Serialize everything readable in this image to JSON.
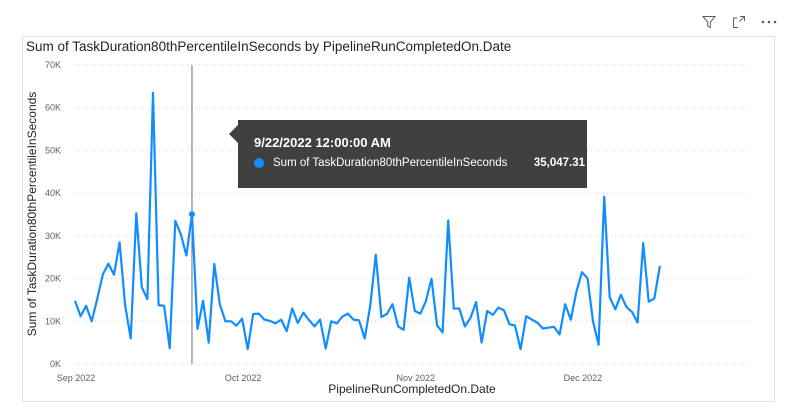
{
  "header_icons": [
    "filter-icon",
    "focus-mode-icon",
    "more-options-icon"
  ],
  "chart_data": {
    "type": "line",
    "title": "Sum of TaskDuration80thPercentileInSeconds by PipelineRunCompletedOn.Date",
    "xlabel": "PipelineRunCompletedOn.Date",
    "ylabel": "Sum of TaskDuration80thPercentileInSeconds",
    "x_ticks": [
      "Sep 2022",
      "Oct 2022",
      "Nov 2022",
      "Dec 2022"
    ],
    "y_ticks": [
      "0K",
      "10K",
      "20K",
      "30K",
      "40K",
      "50K",
      "60K",
      "70K"
    ],
    "ylim": [
      0,
      70000
    ],
    "x_start": "2022-09-01",
    "x_end": "2022-12-31",
    "grid": "horizontal dotted",
    "color": "#118DFF",
    "series": [
      {
        "name": "Sum of TaskDuration80thPercentileInSeconds",
        "points": [
          [
            "2022-09-01",
            14800
          ],
          [
            "2022-09-02",
            11200
          ],
          [
            "2022-09-03",
            13600
          ],
          [
            "2022-09-04",
            10000
          ],
          [
            "2022-09-05",
            15300
          ],
          [
            "2022-09-06",
            21000
          ],
          [
            "2022-09-07",
            23500
          ],
          [
            "2022-09-08",
            20900
          ],
          [
            "2022-09-09",
            28500
          ],
          [
            "2022-09-10",
            13800
          ],
          [
            "2022-09-11",
            6000
          ],
          [
            "2022-09-12",
            35300
          ],
          [
            "2022-09-13",
            18000
          ],
          [
            "2022-09-14",
            15200
          ],
          [
            "2022-09-15",
            63500
          ],
          [
            "2022-09-16",
            13800
          ],
          [
            "2022-09-17",
            13600
          ],
          [
            "2022-09-18",
            3700
          ],
          [
            "2022-09-19",
            33500
          ],
          [
            "2022-09-20",
            30400
          ],
          [
            "2022-09-21",
            25400
          ],
          [
            "2022-09-22",
            35047
          ],
          [
            "2022-09-23",
            8200
          ],
          [
            "2022-09-24",
            14800
          ],
          [
            "2022-09-25",
            5000
          ],
          [
            "2022-09-26",
            23400
          ],
          [
            "2022-09-27",
            14000
          ],
          [
            "2022-09-28",
            10000
          ],
          [
            "2022-09-29",
            10000
          ],
          [
            "2022-09-30",
            9000
          ],
          [
            "2022-10-01",
            10600
          ],
          [
            "2022-10-02",
            3500
          ],
          [
            "2022-10-03",
            11700
          ],
          [
            "2022-10-04",
            11800
          ],
          [
            "2022-10-05",
            10400
          ],
          [
            "2022-10-06",
            10100
          ],
          [
            "2022-10-07",
            9500
          ],
          [
            "2022-10-08",
            10400
          ],
          [
            "2022-10-09",
            7700
          ],
          [
            "2022-10-10",
            13000
          ],
          [
            "2022-10-11",
            9600
          ],
          [
            "2022-10-12",
            12000
          ],
          [
            "2022-10-13",
            10300
          ],
          [
            "2022-10-14",
            8800
          ],
          [
            "2022-10-15",
            10400
          ],
          [
            "2022-10-16",
            3600
          ],
          [
            "2022-10-17",
            10000
          ],
          [
            "2022-10-18",
            9500
          ],
          [
            "2022-10-19",
            11100
          ],
          [
            "2022-10-20",
            11800
          ],
          [
            "2022-10-21",
            10400
          ],
          [
            "2022-10-22",
            10200
          ],
          [
            "2022-10-23",
            6000
          ],
          [
            "2022-10-24",
            13600
          ],
          [
            "2022-10-25",
            25600
          ],
          [
            "2022-10-26",
            11000
          ],
          [
            "2022-10-27",
            11700
          ],
          [
            "2022-10-28",
            14000
          ],
          [
            "2022-10-29",
            8800
          ],
          [
            "2022-10-30",
            8000
          ],
          [
            "2022-10-31",
            20200
          ],
          [
            "2022-11-01",
            12400
          ],
          [
            "2022-11-02",
            11800
          ],
          [
            "2022-11-03",
            14700
          ],
          [
            "2022-11-04",
            20000
          ],
          [
            "2022-11-05",
            9000
          ],
          [
            "2022-11-06",
            7400
          ],
          [
            "2022-11-07",
            33600
          ],
          [
            "2022-11-08",
            13000
          ],
          [
            "2022-11-09",
            13000
          ],
          [
            "2022-11-10",
            8800
          ],
          [
            "2022-11-11",
            10800
          ],
          [
            "2022-11-12",
            14500
          ],
          [
            "2022-11-13",
            5000
          ],
          [
            "2022-11-14",
            12400
          ],
          [
            "2022-11-15",
            11500
          ],
          [
            "2022-11-16",
            13200
          ],
          [
            "2022-11-17",
            12600
          ],
          [
            "2022-11-18",
            9300
          ],
          [
            "2022-11-19",
            9000
          ],
          [
            "2022-11-20",
            3500
          ],
          [
            "2022-11-21",
            11200
          ],
          [
            "2022-11-22",
            10400
          ],
          [
            "2022-11-23",
            9700
          ],
          [
            "2022-11-24",
            8300
          ],
          [
            "2022-11-25",
            8500
          ],
          [
            "2022-11-26",
            8700
          ],
          [
            "2022-11-27",
            6900
          ],
          [
            "2022-11-28",
            14000
          ],
          [
            "2022-11-29",
            10400
          ],
          [
            "2022-11-30",
            16800
          ],
          [
            "2022-12-01",
            21500
          ],
          [
            "2022-12-02",
            20100
          ],
          [
            "2022-12-03",
            10000
          ],
          [
            "2022-12-04",
            4500
          ],
          [
            "2022-12-05",
            39200
          ],
          [
            "2022-12-06",
            15600
          ],
          [
            "2022-12-07",
            12800
          ],
          [
            "2022-12-08",
            16200
          ],
          [
            "2022-12-09",
            13300
          ],
          [
            "2022-12-10",
            12200
          ],
          [
            "2022-12-11",
            9700
          ],
          [
            "2022-12-12",
            28300
          ],
          [
            "2022-12-13",
            14600
          ],
          [
            "2022-12-14",
            15300
          ],
          [
            "2022-12-15",
            23000
          ]
        ]
      }
    ],
    "hover": {
      "x": "2022-09-22",
      "date_label": "9/22/2022 12:00:00 AM",
      "series_label": "Sum of TaskDuration80thPercentileInSeconds",
      "value_label": "35,047.31"
    }
  }
}
